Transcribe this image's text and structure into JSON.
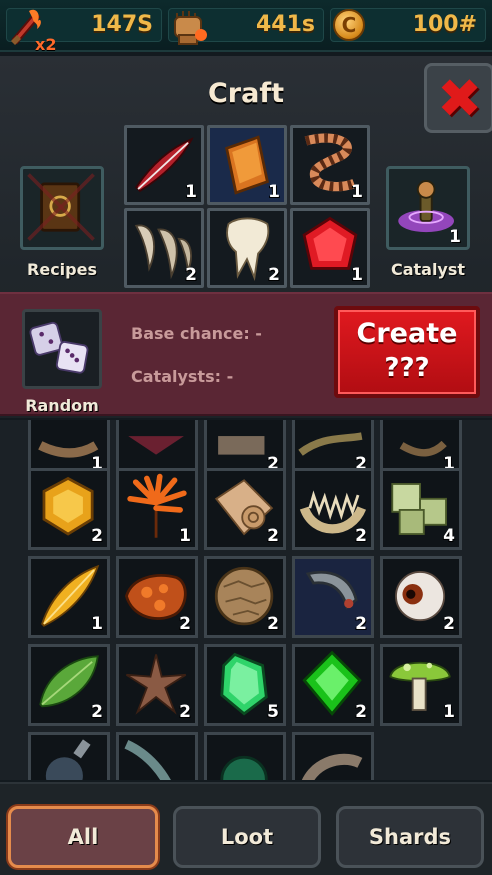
{
  "resources": {
    "energy": {
      "value": "147S",
      "multiplier": "x2",
      "icon": "flame-sword-icon"
    },
    "power": {
      "value": "441s",
      "icon": "fist-icon"
    },
    "coins": {
      "value": "100#",
      "icon": "coin-icon",
      "symbol": "C"
    }
  },
  "craft": {
    "title": "Craft",
    "close_icon": "close-x-icon",
    "recipes_label": "Recipes",
    "catalyst_label": "Catalyst",
    "catalyst_count": "1",
    "ingredients": [
      {
        "name": "red-feather",
        "count": "1"
      },
      {
        "name": "copper-ingot",
        "count": "1"
      },
      {
        "name": "striped-worm",
        "count": "1"
      },
      {
        "name": "claws",
        "count": "2"
      },
      {
        "name": "tooth",
        "count": "2"
      },
      {
        "name": "red-gem",
        "count": "1"
      }
    ],
    "random_label": "Random",
    "base_chance": "Base chance: -",
    "catalysts": "Catalysts: -",
    "create_label": "Create",
    "create_result": "???"
  },
  "inventory": {
    "partial_row_counts": [
      "1",
      "",
      "2",
      "2",
      "1"
    ],
    "rows": [
      [
        {
          "name": "amber-gem",
          "count": "2"
        },
        {
          "name": "fire-leaf",
          "count": "1"
        },
        {
          "name": "scroll",
          "count": "2"
        },
        {
          "name": "jawbone",
          "count": "2"
        },
        {
          "name": "green-cubes",
          "count": "4"
        }
      ],
      [
        {
          "name": "yellow-feather",
          "count": "1"
        },
        {
          "name": "lava-rock",
          "count": "2"
        },
        {
          "name": "stone-ball",
          "count": "2"
        },
        {
          "name": "metal-bracer",
          "count": "2"
        },
        {
          "name": "eyeball",
          "count": "2"
        }
      ],
      [
        {
          "name": "green-leaf",
          "count": "2"
        },
        {
          "name": "starfish",
          "count": "2"
        },
        {
          "name": "green-crystal",
          "count": "5"
        },
        {
          "name": "emerald",
          "count": "2"
        },
        {
          "name": "mushroom",
          "count": "1"
        }
      ]
    ]
  },
  "tabs": [
    {
      "label": "All",
      "active": true
    },
    {
      "label": "Loot",
      "active": false
    },
    {
      "label": "Shards",
      "active": false
    }
  ],
  "colors": {
    "accent_gold": "#f0b849",
    "create_red": "#d4161b",
    "craft_strip": "#5a2634",
    "active_tab_border": "#e58b4c"
  }
}
